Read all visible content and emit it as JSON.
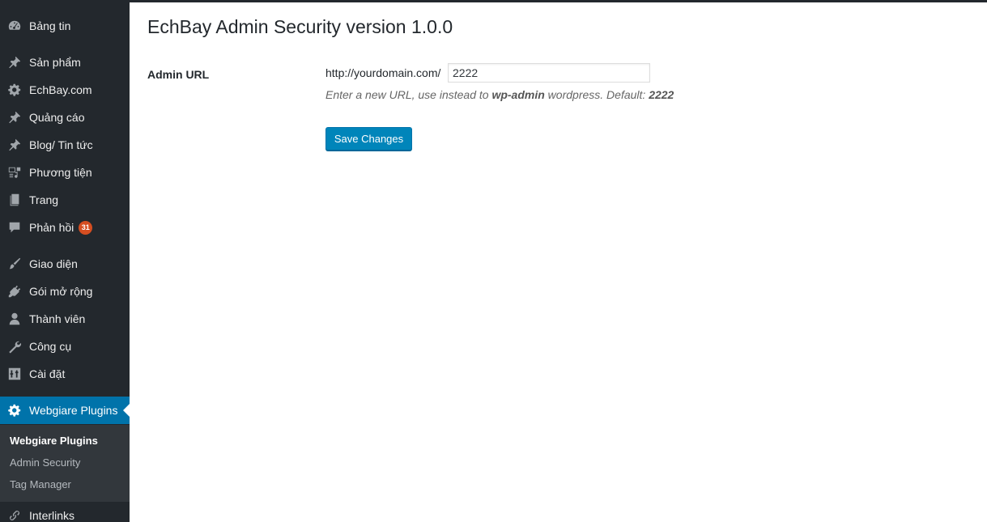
{
  "sidebar": {
    "items": [
      {
        "label": "Bảng tin",
        "icon": "dashboard-icon"
      },
      {
        "label": "Sản phẩm",
        "icon": "pin-icon"
      },
      {
        "label": "EchBay.com",
        "icon": "gear-icon"
      },
      {
        "label": "Quảng cáo",
        "icon": "pin-icon"
      },
      {
        "label": "Blog/ Tin tức",
        "icon": "pin-icon"
      },
      {
        "label": "Phương tiện",
        "icon": "media-icon"
      },
      {
        "label": "Trang",
        "icon": "pages-icon"
      },
      {
        "label": "Phản hồi",
        "icon": "comment-icon",
        "badge": "31"
      },
      {
        "label": "Giao diện",
        "icon": "brush-icon"
      },
      {
        "label": "Gói mở rộng",
        "icon": "plugin-icon"
      },
      {
        "label": "Thành viên",
        "icon": "user-icon"
      },
      {
        "label": "Công cụ",
        "icon": "wrench-icon"
      },
      {
        "label": "Cài đặt",
        "icon": "settings-icon"
      },
      {
        "label": "Webgiare Plugins",
        "icon": "gear-icon",
        "active": true
      },
      {
        "label": "Interlinks",
        "icon": "link-icon"
      }
    ],
    "submenu": [
      {
        "label": "Webgiare Plugins",
        "current": true
      },
      {
        "label": "Admin Security"
      },
      {
        "label": "Tag Manager"
      }
    ]
  },
  "main": {
    "title": "EchBay Admin Security version 1.0.0",
    "field_label": "Admin URL",
    "url_prefix": "http://yourdomain.com/",
    "url_value": "2222",
    "description": {
      "before": "Enter a new URL, use instead to ",
      "strong1": "wp-admin",
      "middle": " wordpress. Default: ",
      "strong2": "2222"
    },
    "save_label": "Save Changes"
  },
  "colors": {
    "sidebar_bg": "#23282d",
    "submenu_bg": "#32373c",
    "accent": "#0073aa",
    "button": "#0085ba",
    "badge": "#d54e21"
  }
}
